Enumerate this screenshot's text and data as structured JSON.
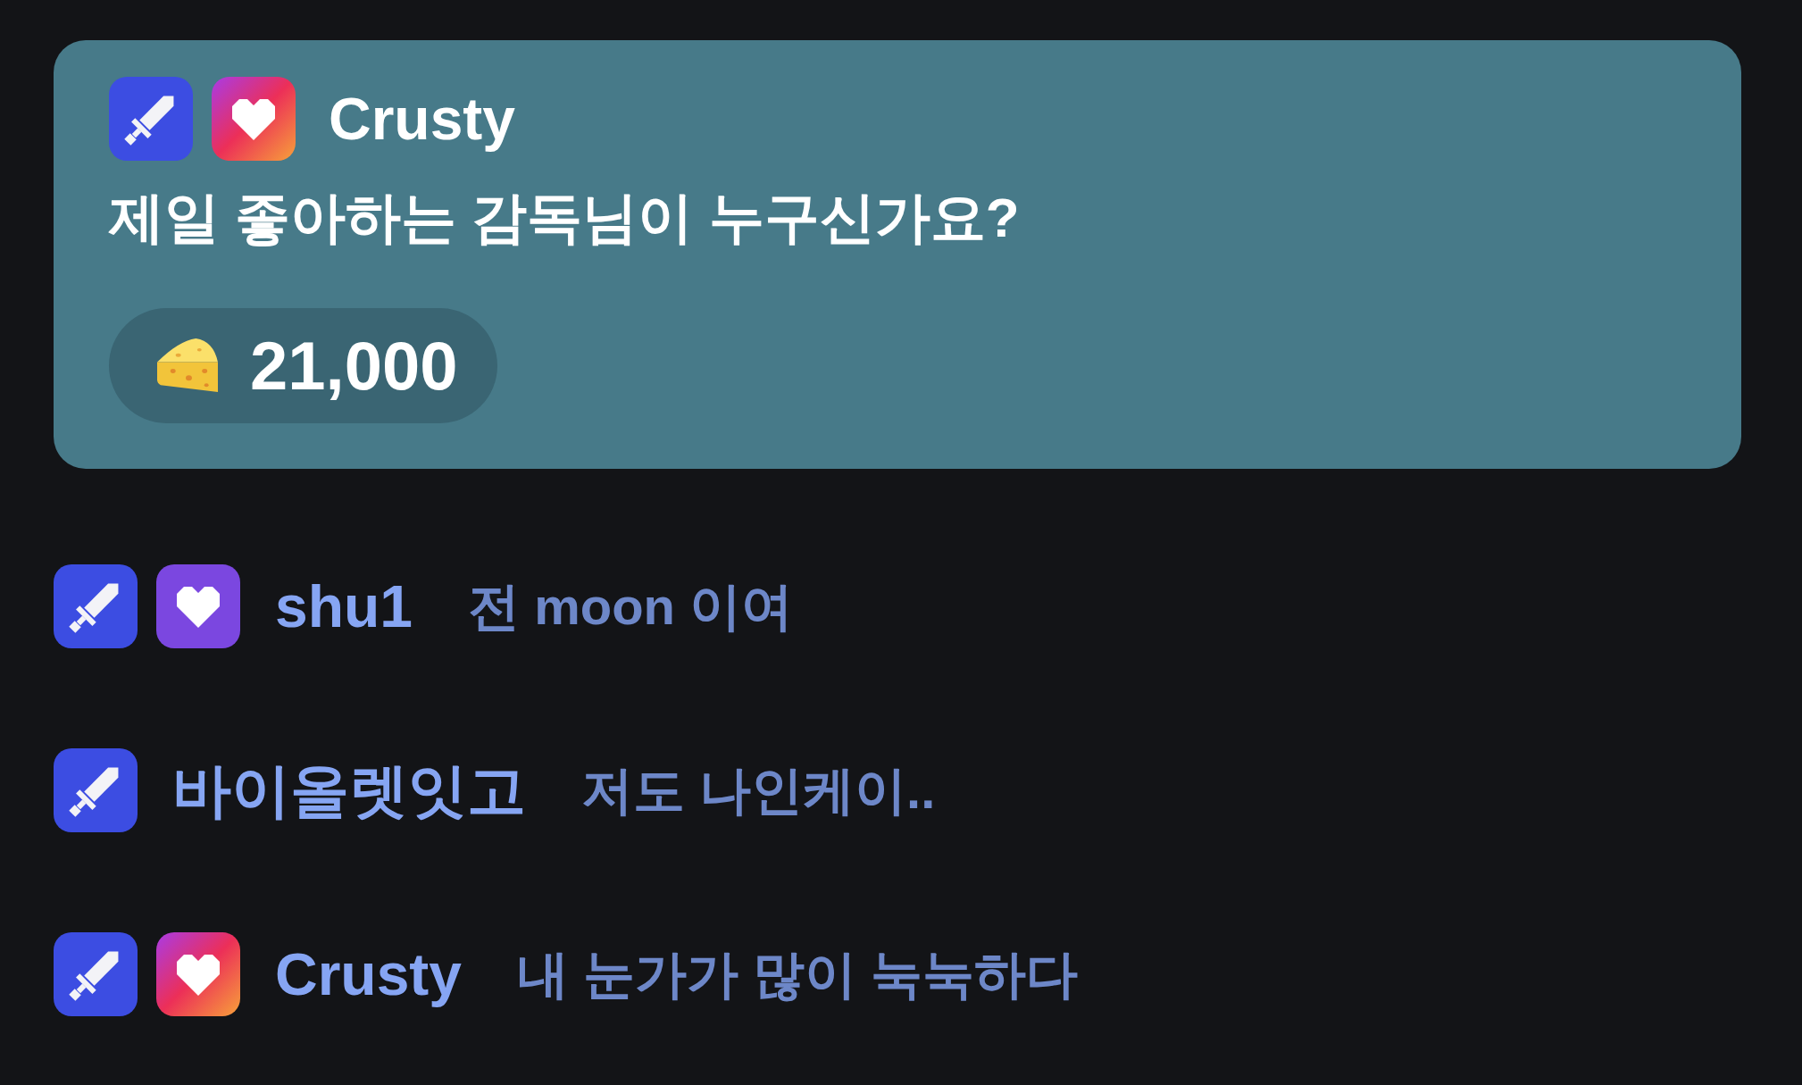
{
  "pinned_message": {
    "badges": [
      {
        "kind": "sword"
      },
      {
        "kind": "gradientheart"
      }
    ],
    "username": "Crusty",
    "text": "제일 좋아하는 감독님이 누구신가요?",
    "donation": {
      "amount": "21,000"
    }
  },
  "chat": [
    {
      "badges": [
        {
          "kind": "sword"
        },
        {
          "kind": "heart"
        }
      ],
      "username": "shu1",
      "text": "전 moon 이여"
    },
    {
      "badges": [
        {
          "kind": "sword"
        }
      ],
      "username": "바이올렛잇고",
      "text": "저도 나인케이.."
    },
    {
      "badges": [
        {
          "kind": "sword"
        },
        {
          "kind": "gradientheart"
        }
      ],
      "username": "Crusty",
      "text": "내 눈가가 많이 눅눅하다"
    }
  ]
}
